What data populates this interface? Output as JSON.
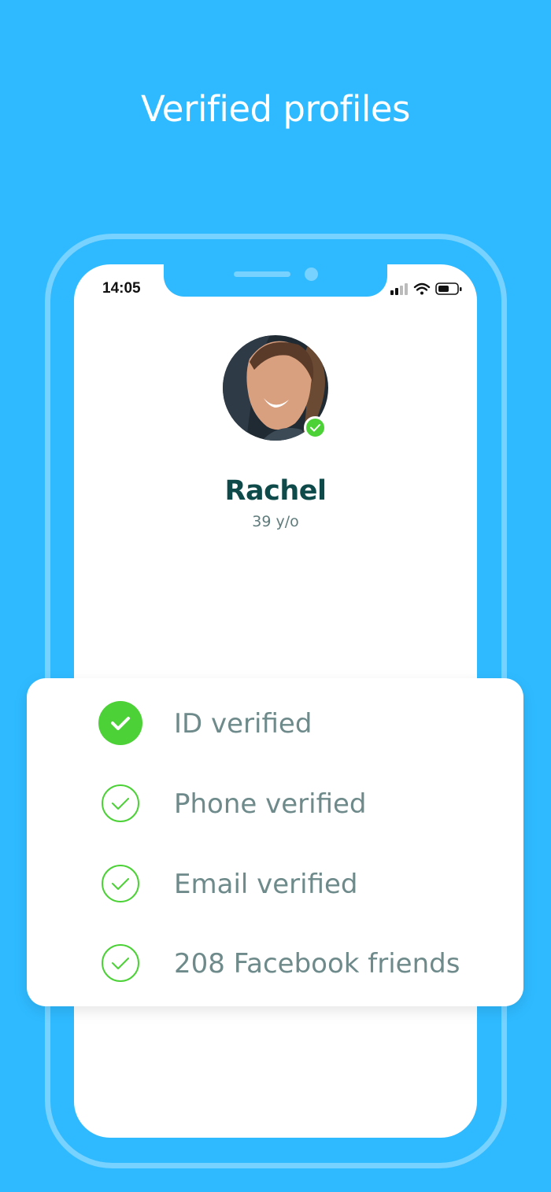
{
  "headline": "Verified profiles",
  "status_bar": {
    "time": "14:05",
    "icons": [
      "signal-icon",
      "wifi-icon",
      "battery-icon"
    ]
  },
  "profile": {
    "name": "Rachel",
    "age": "39 y/o",
    "verified_badge": "check-icon"
  },
  "verifications": [
    {
      "label": "ID verified",
      "state": "filled"
    },
    {
      "label": "Phone verified",
      "state": "outline"
    },
    {
      "label": "Email verified",
      "state": "outline"
    },
    {
      "label": "208 Facebook friends",
      "state": "outline"
    }
  ],
  "colors": {
    "background": "#2fbaff",
    "check_green": "#4cd137",
    "name": "#0f4a4a",
    "label": "#6e8a8a"
  }
}
